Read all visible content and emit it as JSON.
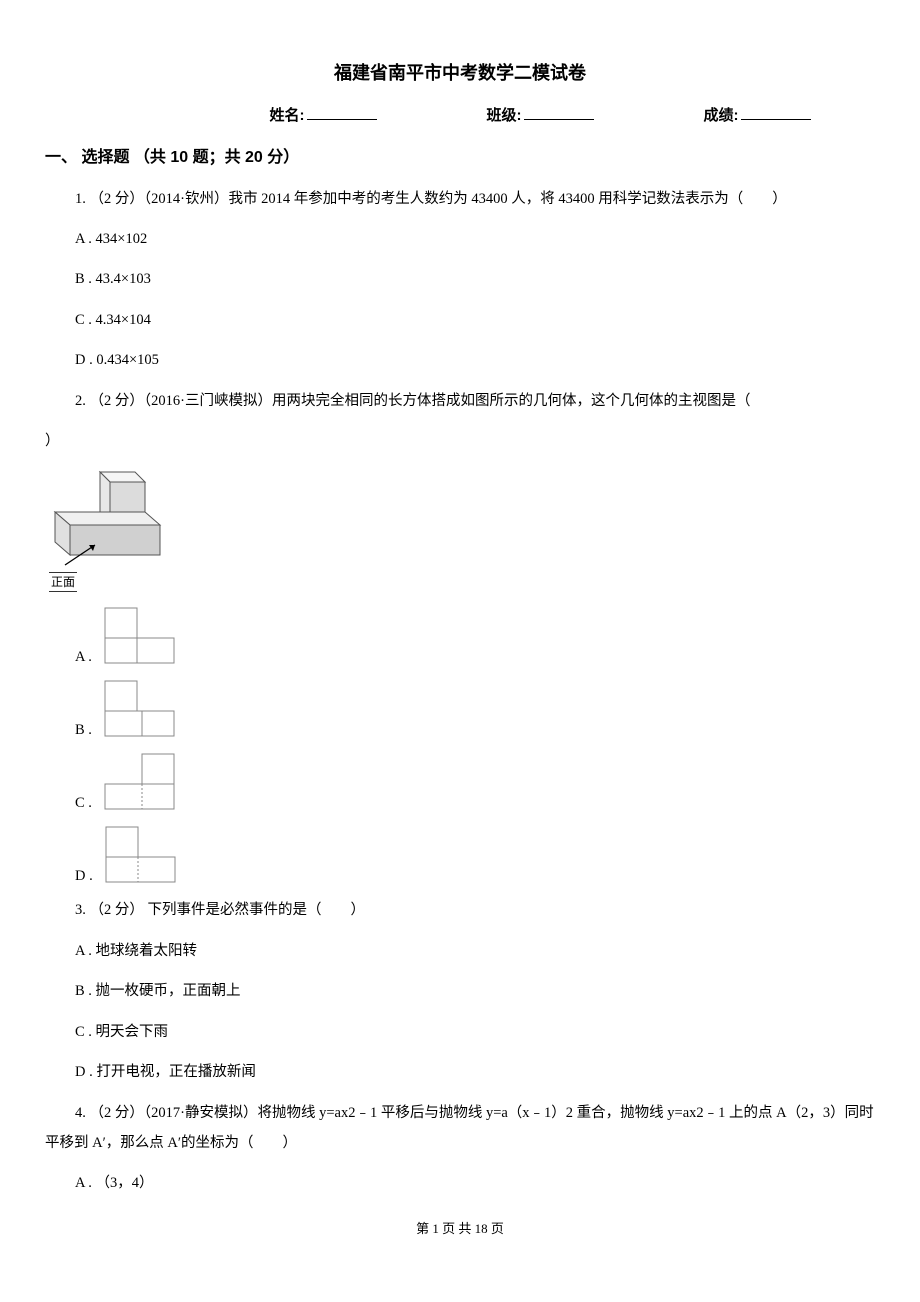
{
  "title": "福建省南平市中考数学二模试卷",
  "fields": {
    "name_label": "姓名:",
    "class_label": "班级:",
    "score_label": "成绩:"
  },
  "section1": {
    "heading": "一、 选择题 （共 10 题；共 20 分）",
    "q1": {
      "stem": "1.  （2 分）（2014·钦州）我市 2014 年参加中考的考生人数约为 43400 人，将 43400 用科学记数法表示为（　　）",
      "A": "A .  434×102",
      "B": "B .  43.4×103",
      "C": "C .  4.34×104",
      "D": "D .  0.434×105"
    },
    "q2": {
      "stem_a": "2.  （2 分）（2016·三门峡模拟）用两块完全相同的长方体搭成如图所示的几何体，这个几何体的主视图是（",
      "stem_b": "）",
      "front_label": "正面",
      "A": "A .",
      "B": "B .",
      "C": "C .",
      "D": "D ."
    },
    "q3": {
      "stem": "3.  （2 分） 下列事件是必然事件的是（　　）",
      "A": "A .  地球绕着太阳转",
      "B": "B .  抛一枚硬币，正面朝上",
      "C": "C .  明天会下雨",
      "D": "D .  打开电视，正在播放新闻"
    },
    "q4": {
      "stem": "4.  （2 分）（2017·静安模拟）将抛物线 y=ax2﹣1 平移后与抛物线 y=a（x﹣1）2 重合，抛物线 y=ax2﹣1 上的点 A（2，3）同时平移到 A′，那么点 A′的坐标为（　　）",
      "A": "A .  （3，4）"
    }
  },
  "footer": "第 1 页 共 18 页"
}
